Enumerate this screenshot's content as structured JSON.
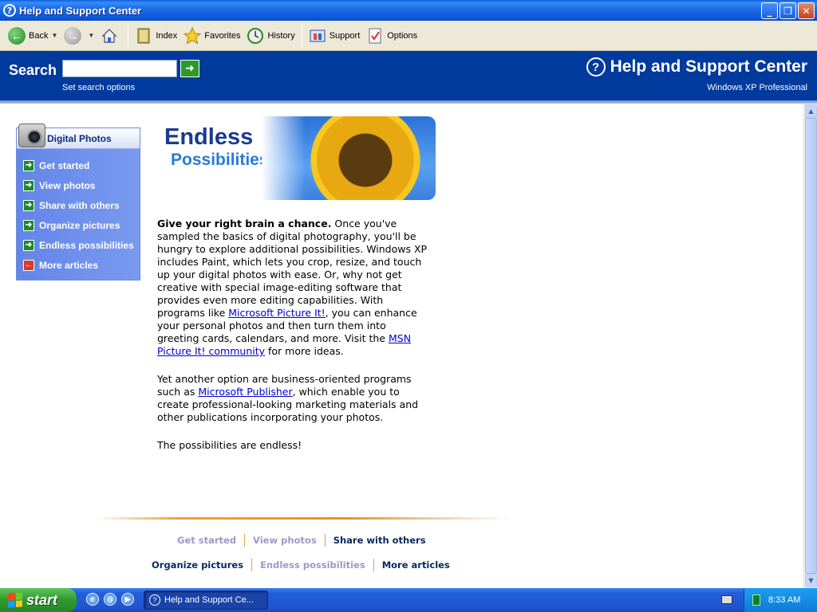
{
  "window": {
    "title": "Help and Support Center",
    "controls": [
      "minimize",
      "restore",
      "close"
    ]
  },
  "toolbar": {
    "back_label": "Back",
    "index_label": "Index",
    "favorites_label": "Favorites",
    "history_label": "History",
    "support_label": "Support",
    "options_label": "Options"
  },
  "search": {
    "label": "Search",
    "value": "",
    "options_link": "Set search options"
  },
  "header": {
    "title": "Help and Support Center",
    "subtitle": "Windows XP Professional"
  },
  "sidebar": {
    "title": "Digital Photos",
    "items": [
      {
        "label": "Get started",
        "icon": "arrow-right-icon"
      },
      {
        "label": "View photos",
        "icon": "arrow-right-icon"
      },
      {
        "label": "Share with others",
        "icon": "arrow-right-icon"
      },
      {
        "label": "Organize pictures",
        "icon": "arrow-right-icon"
      },
      {
        "label": "Endless possibilities",
        "icon": "arrow-right-icon"
      },
      {
        "label": "More articles",
        "icon": "arrow-left-icon"
      }
    ]
  },
  "banner": {
    "line1": "Endless",
    "line2": "Possibilities"
  },
  "article": {
    "p1_bold": "Give your right brain a chance.",
    "p1_a": " Once you've sampled the basics of digital photography, you'll be hungry to explore additional possibilities. Windows XP includes Paint, which lets you crop, resize, and touch up your digital photos with ease. Or, why not get creative with special image-editing software that provides even more editing capabilities. With programs like ",
    "p1_link1": "Microsoft Picture It!",
    "p1_b": ", you can enhance your personal photos and then turn them into greeting cards, calendars, and more. Visit the ",
    "p1_link2": "MSN Picture It! community",
    "p1_c": " for more ideas.",
    "p2_a": "Yet another option are business-oriented programs such as ",
    "p2_link": "Microsoft Publisher",
    "p2_b": ", which enable you to create professional-looking marketing materials and other publications incorporating your photos.",
    "p3": "The possibilities are endless!"
  },
  "footer_nav": {
    "row1": [
      "Get started",
      "View photos",
      "Share with others"
    ],
    "row2": [
      "Organize pictures",
      "Endless possibilities",
      "More articles"
    ]
  },
  "taskbar": {
    "start_label": "start",
    "task_label": "Help and Support Ce...",
    "clock": "8:33 AM"
  }
}
